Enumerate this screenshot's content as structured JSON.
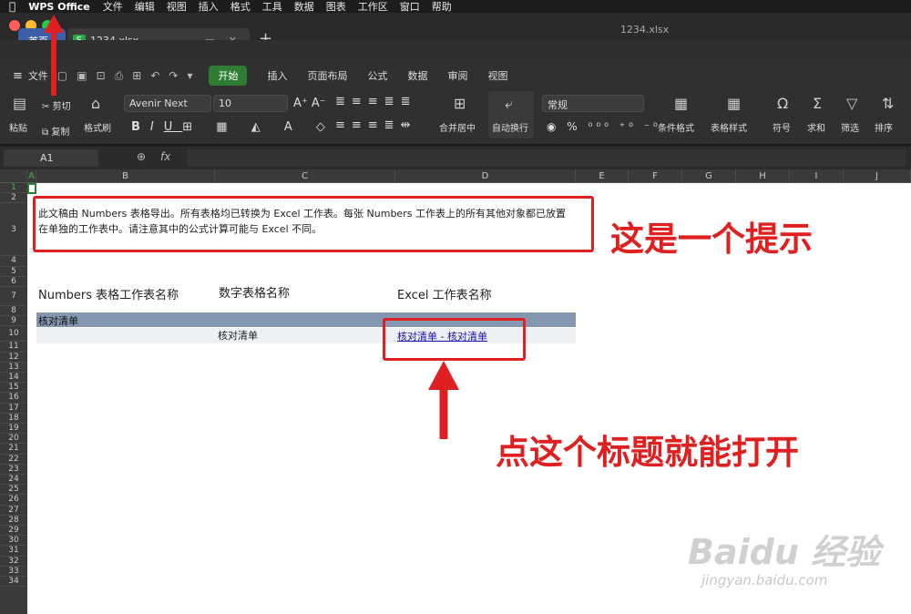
{
  "menubar": {
    "app": "WPS Office",
    "items": [
      "文件",
      "编辑",
      "视图",
      "插入",
      "格式",
      "工具",
      "数据",
      "图表",
      "工作区",
      "窗口",
      "帮助"
    ]
  },
  "tabs": {
    "home": "首页",
    "file": "1234.xlsx",
    "doc_title": "1234.xlsx"
  },
  "menu": {
    "file_label": "文件",
    "ribbon_tabs": [
      "开始",
      "插入",
      "页面布局",
      "公式",
      "数据",
      "审阅",
      "视图"
    ]
  },
  "ribbon": {
    "paste": "粘贴",
    "cut": "剪切",
    "copy": "复制",
    "format_painter": "格式刷",
    "font_name": "Avenir Next",
    "font_size": "10",
    "merge": "合并居中",
    "wrap": "自动换行",
    "number_format": "常规",
    "conditional": "条件格式",
    "table_style": "表格样式",
    "symbol": "符号",
    "sum": "求和",
    "filter": "筛选",
    "sort": "排序"
  },
  "formula_bar": {
    "cell_ref": "A1",
    "fx": "fx"
  },
  "columns": [
    "A",
    "B",
    "C",
    "D",
    "E",
    "F",
    "G",
    "H",
    "I",
    "J"
  ],
  "rows": [
    "1",
    "2",
    "3",
    "4",
    "5",
    "6",
    "7",
    "8",
    "9",
    "10",
    "11",
    "12",
    "13",
    "14",
    "15",
    "16",
    "17",
    "18",
    "19",
    "20",
    "21",
    "22",
    "23",
    "24",
    "25",
    "26",
    "27",
    "28",
    "29",
    "30",
    "31",
    "32",
    "33",
    "34"
  ],
  "sheet": {
    "note": "此文稿由 Numbers 表格导出。所有表格均已转换为 Excel 工作表。每张 Numbers 工作表上的所有其他对象都已放置在单独的工作表中。请注意其中的公式计算可能与 Excel 不同。",
    "header_numbers": "Numbers 表格工作表名称",
    "header_table": "数字表格名称",
    "header_excel": "Excel 工作表名称",
    "row9_label": "核对清单",
    "row10_table": "核对清单",
    "row10_link": "核对清单 - 核对清单"
  },
  "annotations": {
    "tip": "这是一个提示",
    "instruction": "点这个标题就能打开",
    "accent": "#e02020"
  },
  "watermark": {
    "main": "Baidu 经验",
    "sub": "jingyan.baidu.com"
  }
}
